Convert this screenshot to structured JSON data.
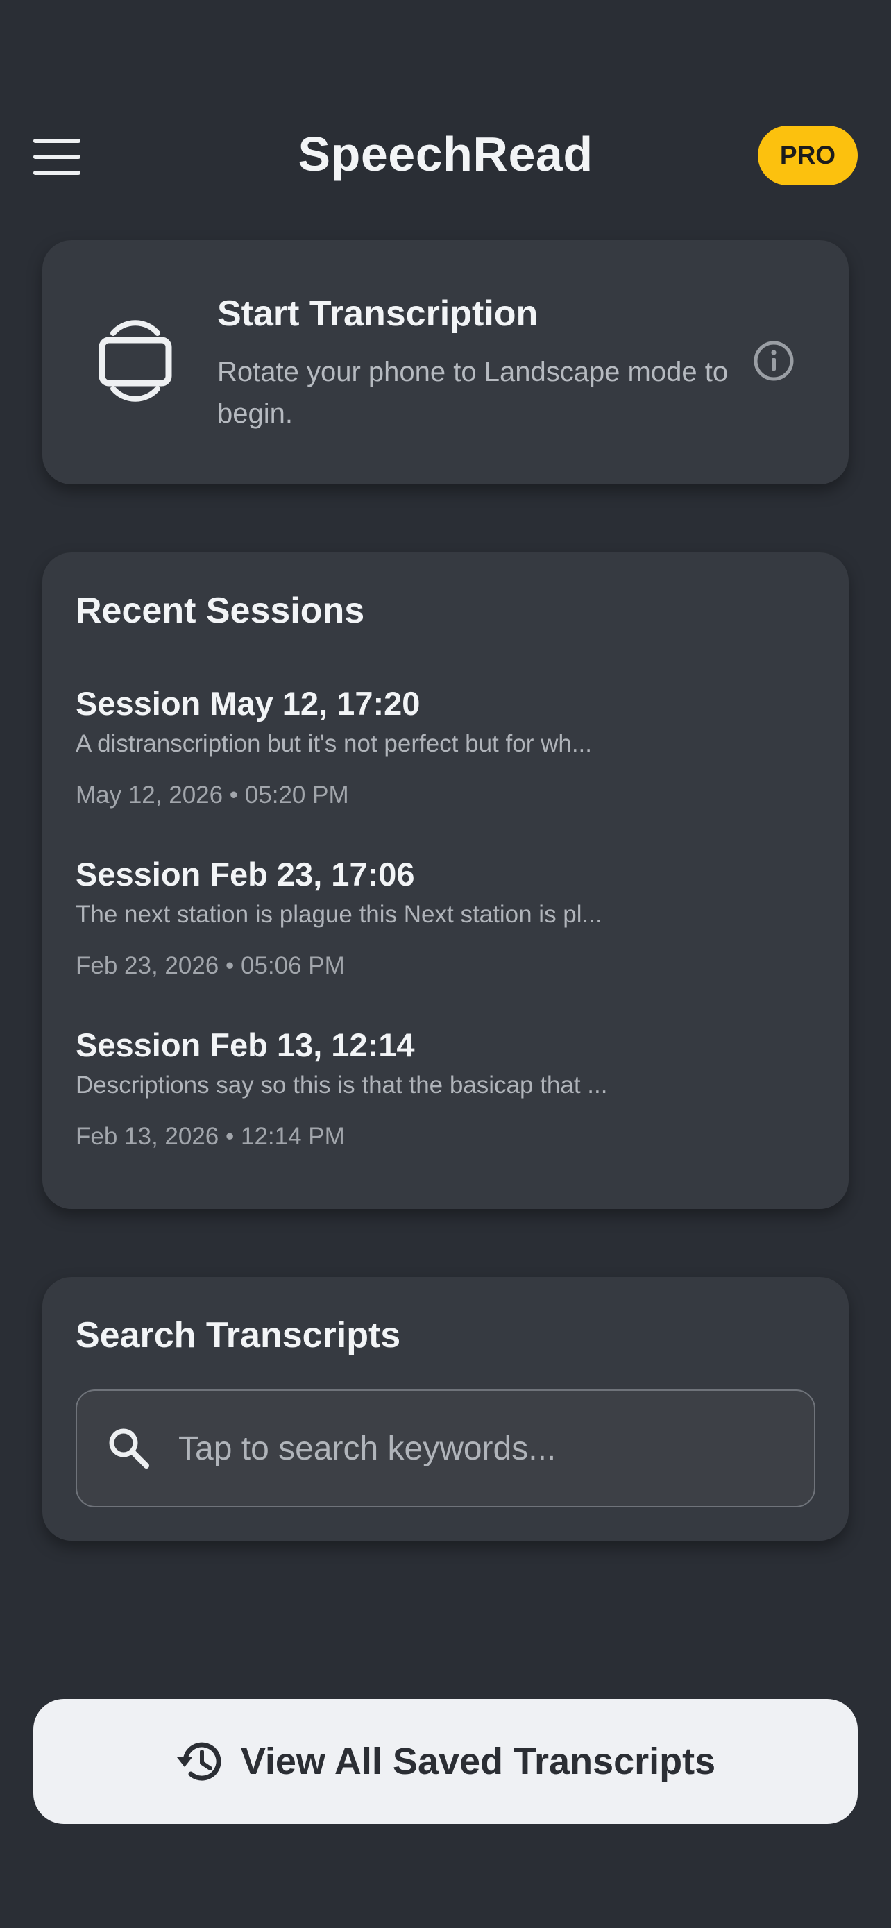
{
  "app": {
    "title": "SpeechRead",
    "badge": "PRO"
  },
  "icons": {
    "menu": "menu-icon",
    "rotate": "screen-rotation-icon",
    "info": "info-icon",
    "search": "search-icon",
    "history": "history-icon"
  },
  "colors": {
    "background": "#2a2e35",
    "card": "#363a41",
    "badge": "#fcc10e",
    "button": "#eff1f4"
  },
  "start": {
    "title": "Start Transcription",
    "subtitle": "Rotate your phone to Landscape mode to begin."
  },
  "recent": {
    "heading": "Recent Sessions",
    "sessions": [
      {
        "title": "Session May 12, 17:20",
        "preview": "A distranscription but it's not perfect but for wh...",
        "date": "May 12, 2026 • 05:20 PM"
      },
      {
        "title": "Session Feb 23, 17:06",
        "preview": "The next station is plague this Next station is pl...",
        "date": "Feb 23, 2026 • 05:06 PM"
      },
      {
        "title": "Session Feb 13, 12:14",
        "preview": "Descriptions say so this is that the basicap that ...",
        "date": "Feb 13, 2026 • 12:14 PM"
      }
    ]
  },
  "search": {
    "heading": "Search Transcripts",
    "placeholder": "Tap to search keywords...",
    "value": ""
  },
  "footer": {
    "button_label": "View All Saved Transcripts"
  }
}
